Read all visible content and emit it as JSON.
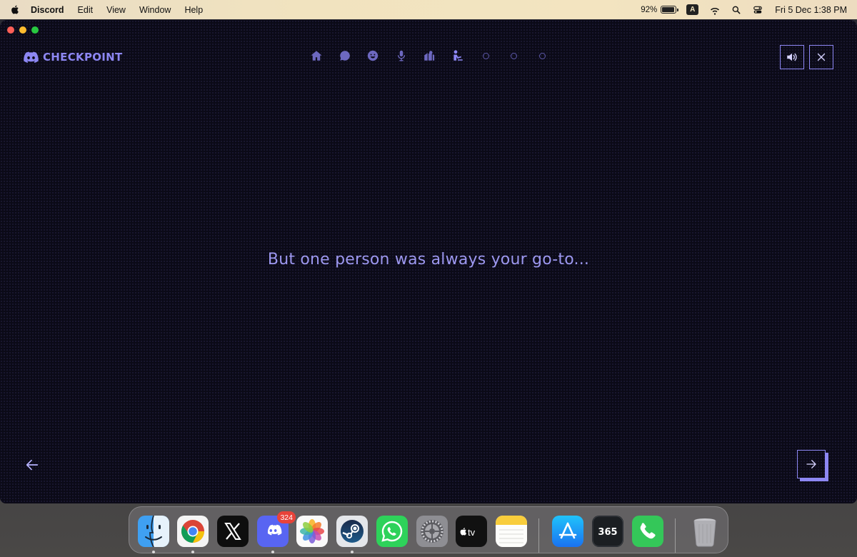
{
  "menubar": {
    "app_name": "Discord",
    "menus": [
      "Edit",
      "View",
      "Window",
      "Help"
    ],
    "battery_percent": "92%",
    "battery_level": 0.92,
    "input_source": "A",
    "datetime": "Fri 5 Dec  1:38 PM",
    "icons": [
      "apple-logo-icon",
      "battery-icon",
      "wifi-icon",
      "spotlight-search-icon",
      "control-center-icon"
    ]
  },
  "window": {
    "logo_text": "CHECKPOINT",
    "progress_steps": [
      "home-icon",
      "chat-bubble-icon",
      "smiley-icon",
      "microphone-icon",
      "servers-icon",
      "person-pointing-icon"
    ],
    "pending_steps": 3,
    "current_step_index": 5,
    "story_text": "But one person was always your go-to...",
    "colors": {
      "background": "#0b0a17",
      "accent": "#8d87f3",
      "text": "#9d98f0",
      "icon": "#6d68c0"
    }
  },
  "dock": {
    "apps": [
      {
        "name": "Finder",
        "icon": "finder-icon",
        "running": true
      },
      {
        "name": "Google Chrome",
        "icon": "chrome-icon",
        "running": true
      },
      {
        "name": "X",
        "icon": "x-icon",
        "running": false
      },
      {
        "name": "Discord",
        "icon": "discord-icon",
        "running": true,
        "badge": "324"
      },
      {
        "name": "Photos",
        "icon": "photos-icon",
        "running": false
      },
      {
        "name": "Steam",
        "icon": "steam-icon",
        "running": true
      },
      {
        "name": "WhatsApp",
        "icon": "whatsapp-icon",
        "running": false
      },
      {
        "name": "System Settings",
        "icon": "settings-icon",
        "running": false
      },
      {
        "name": "Apple TV",
        "icon": "apple-tv-icon",
        "running": false,
        "label": "tv"
      },
      {
        "name": "Notes",
        "icon": "notes-icon",
        "running": false
      },
      {
        "name": "App Store",
        "icon": "app-store-icon",
        "running": false
      },
      {
        "name": "365Scores",
        "icon": "scores-365-icon",
        "running": false,
        "label": "365"
      },
      {
        "name": "Phone",
        "icon": "phone-icon",
        "running": false
      },
      {
        "name": "Trash",
        "icon": "trash-icon",
        "running": false
      }
    ]
  }
}
